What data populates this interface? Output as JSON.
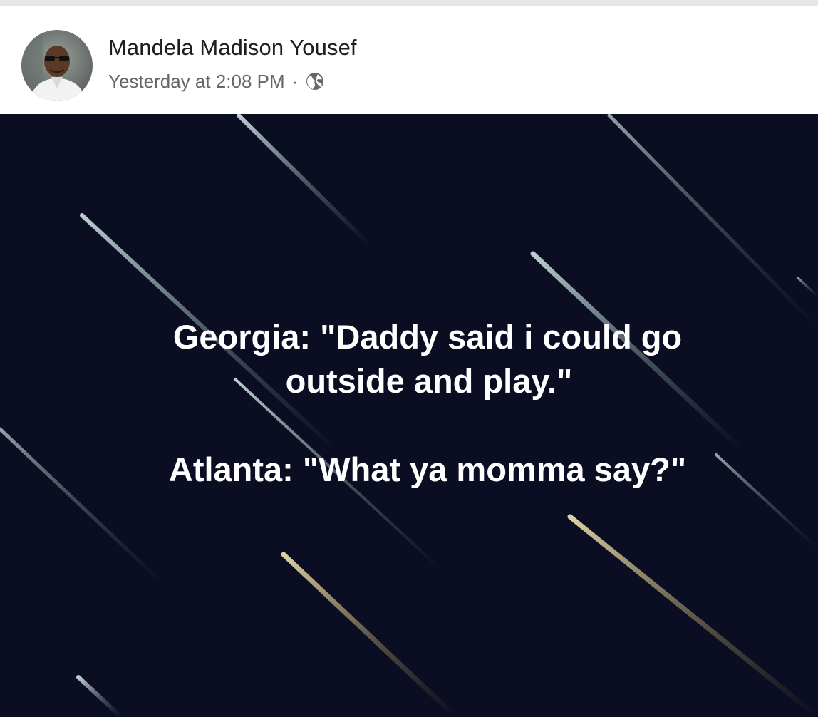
{
  "post": {
    "author": "Mandela Madison Yousef",
    "timestamp": "Yesterday at 2:08 PM",
    "separator": "·",
    "privacy_icon": "globe-icon",
    "avatar_icon": "profile-photo"
  },
  "image": {
    "background_color": "#0b0e22",
    "lines": [
      "Georgia: \"Daddy said i could go",
      "outside and play.\"",
      "Atlanta: \"What ya momma say?\""
    ]
  }
}
